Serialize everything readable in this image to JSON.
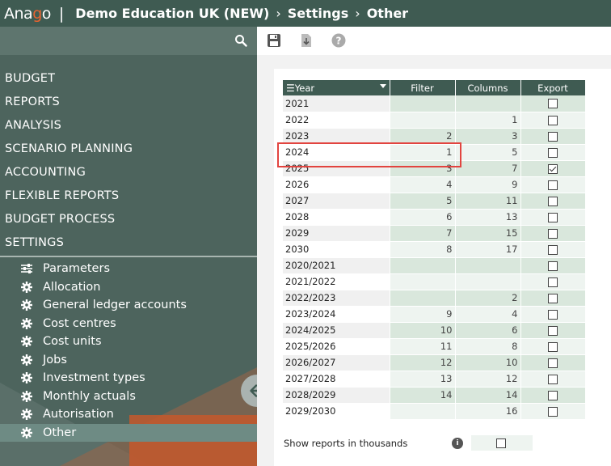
{
  "header": {
    "logo": {
      "part1": "Ana",
      "part2": "g",
      "part3": "o"
    },
    "separator": "|",
    "breadcrumb": [
      "Demo Education UK (NEW)",
      "Settings",
      "Other"
    ]
  },
  "sidebar": {
    "main_items": [
      "BUDGET",
      "REPORTS",
      "ANALYSIS",
      "SCENARIO PLANNING",
      "ACCOUNTING",
      "FLEXIBLE REPORTS",
      "BUDGET PROCESS",
      "SETTINGS"
    ],
    "sub_items": [
      {
        "label": "Parameters",
        "icon": "sliders-icon"
      },
      {
        "label": "Allocation",
        "icon": "gear-icon"
      },
      {
        "label": "General ledger accounts",
        "icon": "gear-icon"
      },
      {
        "label": "Cost centres",
        "icon": "gear-icon"
      },
      {
        "label": "Cost units",
        "icon": "gear-icon"
      },
      {
        "label": "Jobs",
        "icon": "gear-icon"
      },
      {
        "label": "Investment types",
        "icon": "gear-icon"
      },
      {
        "label": "Monthly actuals",
        "icon": "gear-icon"
      },
      {
        "label": "Autorisation",
        "icon": "gear-icon"
      },
      {
        "label": "Other",
        "icon": "gear-icon",
        "active": true
      }
    ]
  },
  "toolbar": {
    "icons": [
      "save-icon",
      "download-icon",
      "help-icon"
    ]
  },
  "table": {
    "headers": {
      "year": "Year",
      "filter": "Filter",
      "columns": "Columns",
      "export": "Export"
    },
    "rows": [
      {
        "year": "2021",
        "filter": "",
        "columns": "",
        "export": false
      },
      {
        "year": "2022",
        "filter": "",
        "columns": "1",
        "export": false
      },
      {
        "year": "2023",
        "filter": "2",
        "columns": "3",
        "export": false
      },
      {
        "year": "2024",
        "filter": "1",
        "columns": "5",
        "export": false
      },
      {
        "year": "2025",
        "filter": "3",
        "columns": "7",
        "export": true
      },
      {
        "year": "2026",
        "filter": "4",
        "columns": "9",
        "export": false
      },
      {
        "year": "2027",
        "filter": "5",
        "columns": "11",
        "export": false
      },
      {
        "year": "2028",
        "filter": "6",
        "columns": "13",
        "export": false
      },
      {
        "year": "2029",
        "filter": "7",
        "columns": "15",
        "export": false
      },
      {
        "year": "2030",
        "filter": "8",
        "columns": "17",
        "export": false
      },
      {
        "year": "2020/2021",
        "filter": "",
        "columns": "",
        "export": false
      },
      {
        "year": "2021/2022",
        "filter": "",
        "columns": "",
        "export": false
      },
      {
        "year": "2022/2023",
        "filter": "",
        "columns": "2",
        "export": false
      },
      {
        "year": "2023/2024",
        "filter": "9",
        "columns": "4",
        "export": false
      },
      {
        "year": "2024/2025",
        "filter": "10",
        "columns": "6",
        "export": false
      },
      {
        "year": "2025/2026",
        "filter": "11",
        "columns": "8",
        "export": false
      },
      {
        "year": "2026/2027",
        "filter": "12",
        "columns": "10",
        "export": false
      },
      {
        "year": "2027/2028",
        "filter": "13",
        "columns": "12",
        "export": false
      },
      {
        "year": "2028/2029",
        "filter": "14",
        "columns": "14",
        "export": false
      },
      {
        "year": "2029/2030",
        "filter": "",
        "columns": "16",
        "export": false
      }
    ]
  },
  "options": {
    "show_thousands_label": "Show reports in thousands",
    "show_thousands_value": false,
    "info_glyph": "i"
  },
  "colors": {
    "header_bg": "#3f5b52",
    "sidebar_bg": "#4d645d",
    "accent": "#e8632f",
    "highlight": "#e2443f"
  }
}
